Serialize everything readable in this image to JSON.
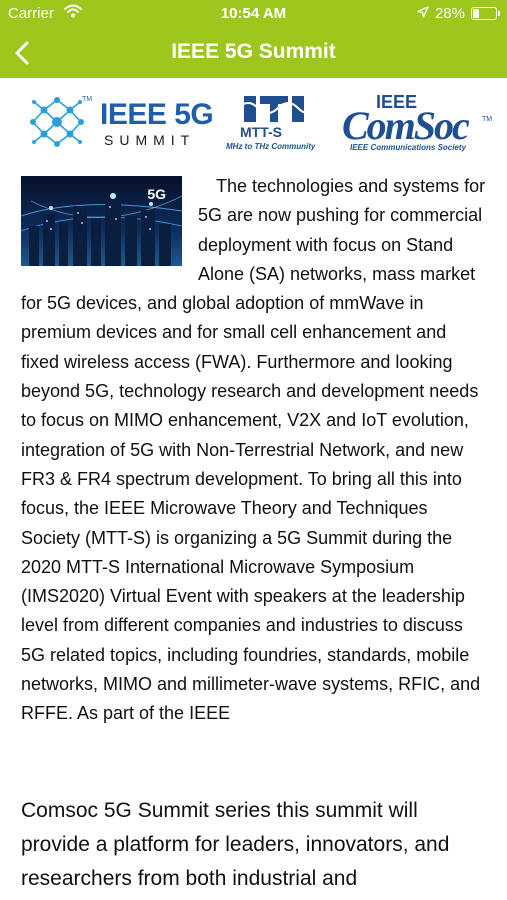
{
  "status_bar": {
    "carrier": "Carrier",
    "time": "10:54 AM",
    "battery": "28%",
    "battery_level": 0.28,
    "icons": [
      "wifi-icon",
      "location-arrow-icon",
      "battery-icon"
    ]
  },
  "nav": {
    "title": "IEEE 5G Summit",
    "back_icon": "chevron-left-icon"
  },
  "logos": {
    "ieee5g": {
      "line1": "IEEE 5G",
      "line2": "SUMMIT",
      "tm": "TM"
    },
    "mtts": {
      "name": "MTT-S",
      "tagline": "MHz to THz Community"
    },
    "comsoc": {
      "top": "IEEE",
      "name": "ComSoc",
      "tagline": "IEEE Communications Society",
      "tm": "TM"
    }
  },
  "article": {
    "image_label": "5G",
    "body": "The technologies and systems for 5G are now pushing for commercial deployment with focus on Stand Alone (SA) networks, mass market for 5G devices, and global adoption of mmWave in premium devices and for small cell enhancement and fixed wireless access (FWA). Furthermore and looking beyond 5G, technology research and development needs to focus on MIMO enhancement, V2X and IoT evolution, integration of 5G with Non-Terrestrial Network, and new FR3 & FR4 spectrum development. To bring all this into focus, the IEEE Microwave Theory and Techniques Society (MTT-S) is organizing a 5G Summit during the 2020 MTT-S International Microwave Symposium (IMS2020) Virtual Event with speakers at the leadership level from different companies and industries to discuss 5G related topics, including foundries, standards, mobile networks, MIMO and millimeter-wave systems, RFIC, and RFFE.  As part of the IEEE",
    "continuation": "Comsoc 5G Summit series this summit will provide a platform for leaders, innovators, and researchers from both industrial and"
  },
  "colors": {
    "header_bg": "#9dc71d",
    "brand_blue": "#1f5ea8",
    "text": "#111111"
  }
}
